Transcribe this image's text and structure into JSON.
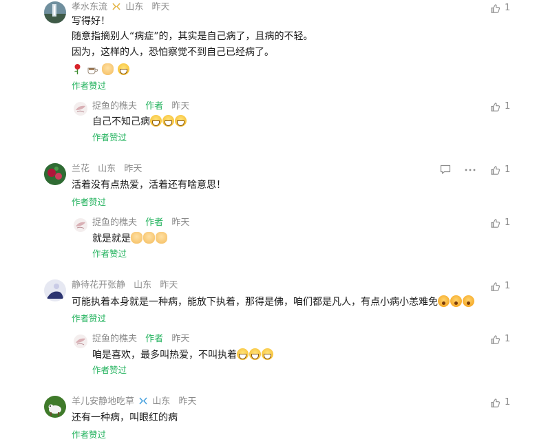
{
  "comments": [
    {
      "user": "孝水东流",
      "region": "山东",
      "time": "昨天",
      "likes": "1",
      "lines": [
        "写得好！",
        "随意指摘别人“病症”的，其实是自己病了，且病的不轻。",
        "因为，这样的人，恐怕察觉不到自己已经病了。"
      ],
      "emoji_line": [
        "rose-emoji",
        "coffee-emoji",
        "handshake-emoji",
        "grin-emoji"
      ],
      "author_liked": "作者赞过",
      "reply": {
        "user": "捉鱼的樵夫",
        "author_tag": "作者",
        "time": "昨天",
        "likes": "1",
        "text": "自己不知己病",
        "emojis": [
          "grin-emoji",
          "grin-emoji",
          "grin-emoji"
        ],
        "author_liked": "作者赞过"
      }
    },
    {
      "user": "兰花",
      "region": "山东",
      "time": "昨天",
      "likes": "1",
      "text": "活着没有点热爱，活着还有啥意思！",
      "author_liked": "作者赞过",
      "reply": {
        "user": "捉鱼的樵夫",
        "author_tag": "作者",
        "time": "昨天",
        "likes": "1",
        "text": "就是就是",
        "emojis": [
          "clap-emoji",
          "clap-emoji",
          "clap-emoji"
        ],
        "author_liked": "作者赞过"
      }
    },
    {
      "user": "静待花开张静",
      "region": "山东",
      "time": "昨天",
      "likes": "1",
      "text": "可能执着本身就是一种病，能放下执着，那得是佛，咱们都是凡人，有点小病小恙难免",
      "emojis": [
        "surprised-emoji",
        "surprised-emoji",
        "surprised-emoji"
      ],
      "author_liked": "作者赞过",
      "reply": {
        "user": "捉鱼的樵夫",
        "author_tag": "作者",
        "time": "昨天",
        "likes": "1",
        "text": "咱是喜欢，最多叫热爱，不叫执着",
        "emojis": [
          "grin-emoji",
          "grin-emoji",
          "grin-emoji"
        ],
        "author_liked": "作者赞过"
      }
    },
    {
      "user": "羊儿安静地吃草",
      "region": "山东",
      "time": "昨天",
      "likes": "1",
      "text": "还有一种病，叫眼红的病",
      "author_liked": "作者赞过"
    }
  ],
  "colors": {
    "accent": "#21b25c",
    "meta": "#8a8a8a",
    "text": "#1a1a1a"
  }
}
